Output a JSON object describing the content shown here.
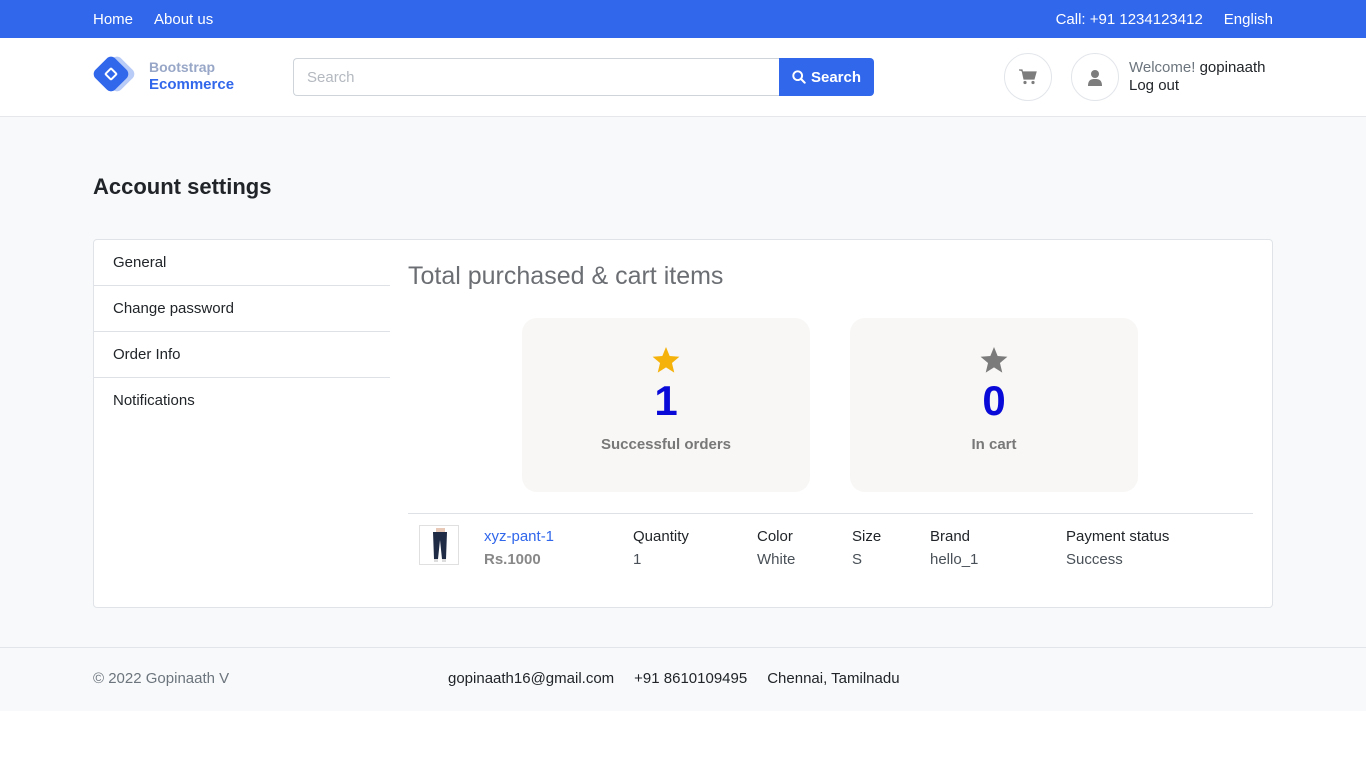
{
  "topbar": {
    "home": "Home",
    "about": "About us",
    "call": "Call: +91 1234123412",
    "language": "English"
  },
  "header": {
    "logo_line1": "Bootstrap",
    "logo_line2": "Ecommerce",
    "search_placeholder": "Search",
    "search_value": "",
    "search_button": "Search",
    "welcome_prefix": "Welcome!",
    "username": "gopinaath",
    "logout": "Log out"
  },
  "page": {
    "title": "Account settings"
  },
  "sidebar": {
    "items": [
      {
        "label": "General"
      },
      {
        "label": "Change password"
      },
      {
        "label": "Order Info"
      },
      {
        "label": "Notifications"
      }
    ]
  },
  "summary": {
    "heading": "Total purchased & cart items",
    "stats": [
      {
        "value": "1",
        "label": "Successful orders",
        "icon": "star-icon",
        "color": "#f5b20a"
      },
      {
        "value": "0",
        "label": "In cart",
        "icon": "star-icon",
        "color": "#7b7b7b"
      }
    ]
  },
  "orders": [
    {
      "name": "xyz-pant-1",
      "price": "Rs.1000",
      "quantity_label": "Quantity",
      "quantity": "1",
      "color_label": "Color",
      "color": "White",
      "size_label": "Size",
      "size": "S",
      "brand_label": "Brand",
      "brand": "hello_1",
      "payment_label": "Payment status",
      "payment": "Success"
    }
  ],
  "footer": {
    "copyright": "© 2022 Gopinaath V",
    "email": "gopinaath16@gmail.com",
    "phone": "+91 8610109495",
    "location": "Chennai, Tamilnadu"
  },
  "colors": {
    "primary": "#3167eb",
    "stat_number": "#0a0ad8"
  }
}
